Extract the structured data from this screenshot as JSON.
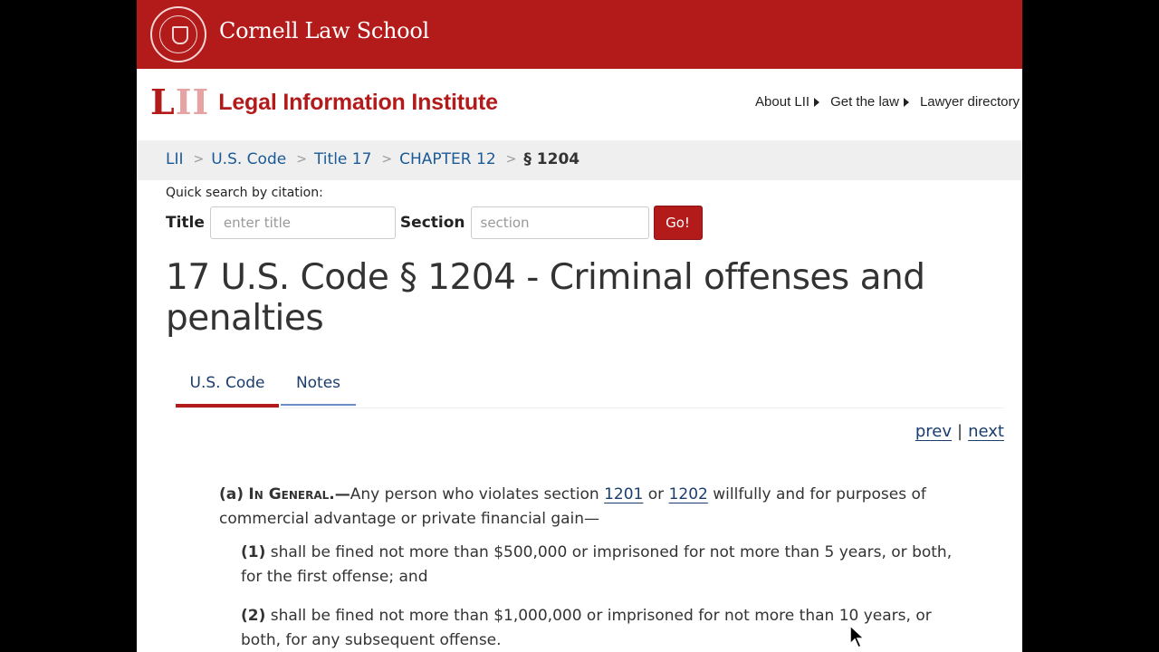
{
  "cornell": {
    "name": "Cornell Law School"
  },
  "lii": {
    "mark": "LII",
    "name": "Legal Information Institute",
    "nav": [
      "About LII",
      "Get the law",
      "Lawyer directory"
    ]
  },
  "breadcrumb": {
    "items": [
      "LII",
      "U.S. Code",
      "Title 17",
      "CHAPTER 12"
    ],
    "current": "§ 1204",
    "separator": ">"
  },
  "quick_search": {
    "label": "Quick search by citation:",
    "title_label": "Title",
    "title_placeholder": "enter title",
    "section_label": "Section",
    "section_placeholder": "section",
    "go_label": "Go!"
  },
  "page_title": "17 U.S. Code § 1204 - Criminal offenses and penalties",
  "tabs": [
    {
      "label": "U.S. Code",
      "active": true
    },
    {
      "label": "Notes",
      "active": false
    }
  ],
  "pager": {
    "prev": "prev",
    "divider": "|",
    "next": "next"
  },
  "content": {
    "a": {
      "num": "(a)",
      "heading": "In General.—",
      "text_before": "Any person who violates section ",
      "ref1": "1201",
      "text_mid": " or ",
      "ref2": "1202",
      "text_after": " willfully and for purposes of commercial advantage or private financial gain—"
    },
    "items": [
      {
        "num": "(1)",
        "text": "shall be fined not more than $500,000 or imprisoned for not more than 5 years, or both, for the first offense; and"
      },
      {
        "num": "(2)",
        "text": "shall be fined not more than $1,000,000 or imprisoned for not more than 10 years, or both, for any subsequent offense."
      }
    ]
  },
  "colors": {
    "brand_red": "#b31b1b",
    "link_blue": "#1a3d6e"
  }
}
